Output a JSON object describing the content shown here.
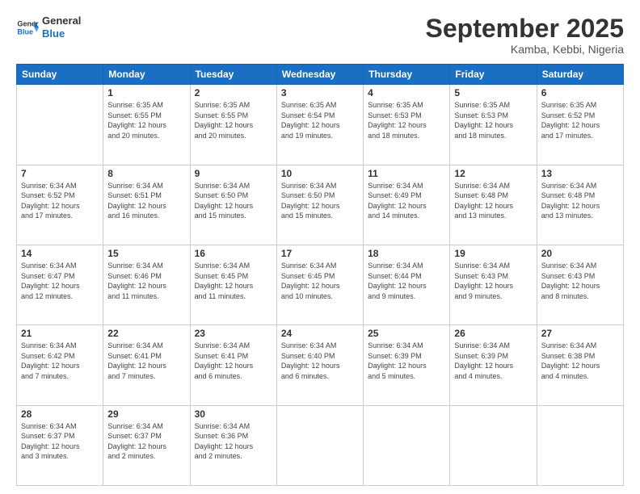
{
  "header": {
    "logo_general": "General",
    "logo_blue": "Blue",
    "month_title": "September 2025",
    "location": "Kamba, Kebbi, Nigeria"
  },
  "days_of_week": [
    "Sunday",
    "Monday",
    "Tuesday",
    "Wednesday",
    "Thursday",
    "Friday",
    "Saturday"
  ],
  "weeks": [
    [
      {
        "day": "",
        "info": ""
      },
      {
        "day": "1",
        "info": "Sunrise: 6:35 AM\nSunset: 6:55 PM\nDaylight: 12 hours\nand 20 minutes."
      },
      {
        "day": "2",
        "info": "Sunrise: 6:35 AM\nSunset: 6:55 PM\nDaylight: 12 hours\nand 20 minutes."
      },
      {
        "day": "3",
        "info": "Sunrise: 6:35 AM\nSunset: 6:54 PM\nDaylight: 12 hours\nand 19 minutes."
      },
      {
        "day": "4",
        "info": "Sunrise: 6:35 AM\nSunset: 6:53 PM\nDaylight: 12 hours\nand 18 minutes."
      },
      {
        "day": "5",
        "info": "Sunrise: 6:35 AM\nSunset: 6:53 PM\nDaylight: 12 hours\nand 18 minutes."
      },
      {
        "day": "6",
        "info": "Sunrise: 6:35 AM\nSunset: 6:52 PM\nDaylight: 12 hours\nand 17 minutes."
      }
    ],
    [
      {
        "day": "7",
        "info": "Sunrise: 6:34 AM\nSunset: 6:52 PM\nDaylight: 12 hours\nand 17 minutes."
      },
      {
        "day": "8",
        "info": "Sunrise: 6:34 AM\nSunset: 6:51 PM\nDaylight: 12 hours\nand 16 minutes."
      },
      {
        "day": "9",
        "info": "Sunrise: 6:34 AM\nSunset: 6:50 PM\nDaylight: 12 hours\nand 15 minutes."
      },
      {
        "day": "10",
        "info": "Sunrise: 6:34 AM\nSunset: 6:50 PM\nDaylight: 12 hours\nand 15 minutes."
      },
      {
        "day": "11",
        "info": "Sunrise: 6:34 AM\nSunset: 6:49 PM\nDaylight: 12 hours\nand 14 minutes."
      },
      {
        "day": "12",
        "info": "Sunrise: 6:34 AM\nSunset: 6:48 PM\nDaylight: 12 hours\nand 13 minutes."
      },
      {
        "day": "13",
        "info": "Sunrise: 6:34 AM\nSunset: 6:48 PM\nDaylight: 12 hours\nand 13 minutes."
      }
    ],
    [
      {
        "day": "14",
        "info": "Sunrise: 6:34 AM\nSunset: 6:47 PM\nDaylight: 12 hours\nand 12 minutes."
      },
      {
        "day": "15",
        "info": "Sunrise: 6:34 AM\nSunset: 6:46 PM\nDaylight: 12 hours\nand 11 minutes."
      },
      {
        "day": "16",
        "info": "Sunrise: 6:34 AM\nSunset: 6:45 PM\nDaylight: 12 hours\nand 11 minutes."
      },
      {
        "day": "17",
        "info": "Sunrise: 6:34 AM\nSunset: 6:45 PM\nDaylight: 12 hours\nand 10 minutes."
      },
      {
        "day": "18",
        "info": "Sunrise: 6:34 AM\nSunset: 6:44 PM\nDaylight: 12 hours\nand 9 minutes."
      },
      {
        "day": "19",
        "info": "Sunrise: 6:34 AM\nSunset: 6:43 PM\nDaylight: 12 hours\nand 9 minutes."
      },
      {
        "day": "20",
        "info": "Sunrise: 6:34 AM\nSunset: 6:43 PM\nDaylight: 12 hours\nand 8 minutes."
      }
    ],
    [
      {
        "day": "21",
        "info": "Sunrise: 6:34 AM\nSunset: 6:42 PM\nDaylight: 12 hours\nand 7 minutes."
      },
      {
        "day": "22",
        "info": "Sunrise: 6:34 AM\nSunset: 6:41 PM\nDaylight: 12 hours\nand 7 minutes."
      },
      {
        "day": "23",
        "info": "Sunrise: 6:34 AM\nSunset: 6:41 PM\nDaylight: 12 hours\nand 6 minutes."
      },
      {
        "day": "24",
        "info": "Sunrise: 6:34 AM\nSunset: 6:40 PM\nDaylight: 12 hours\nand 6 minutes."
      },
      {
        "day": "25",
        "info": "Sunrise: 6:34 AM\nSunset: 6:39 PM\nDaylight: 12 hours\nand 5 minutes."
      },
      {
        "day": "26",
        "info": "Sunrise: 6:34 AM\nSunset: 6:39 PM\nDaylight: 12 hours\nand 4 minutes."
      },
      {
        "day": "27",
        "info": "Sunrise: 6:34 AM\nSunset: 6:38 PM\nDaylight: 12 hours\nand 4 minutes."
      }
    ],
    [
      {
        "day": "28",
        "info": "Sunrise: 6:34 AM\nSunset: 6:37 PM\nDaylight: 12 hours\nand 3 minutes."
      },
      {
        "day": "29",
        "info": "Sunrise: 6:34 AM\nSunset: 6:37 PM\nDaylight: 12 hours\nand 2 minutes."
      },
      {
        "day": "30",
        "info": "Sunrise: 6:34 AM\nSunset: 6:36 PM\nDaylight: 12 hours\nand 2 minutes."
      },
      {
        "day": "",
        "info": ""
      },
      {
        "day": "",
        "info": ""
      },
      {
        "day": "",
        "info": ""
      },
      {
        "day": "",
        "info": ""
      }
    ]
  ]
}
